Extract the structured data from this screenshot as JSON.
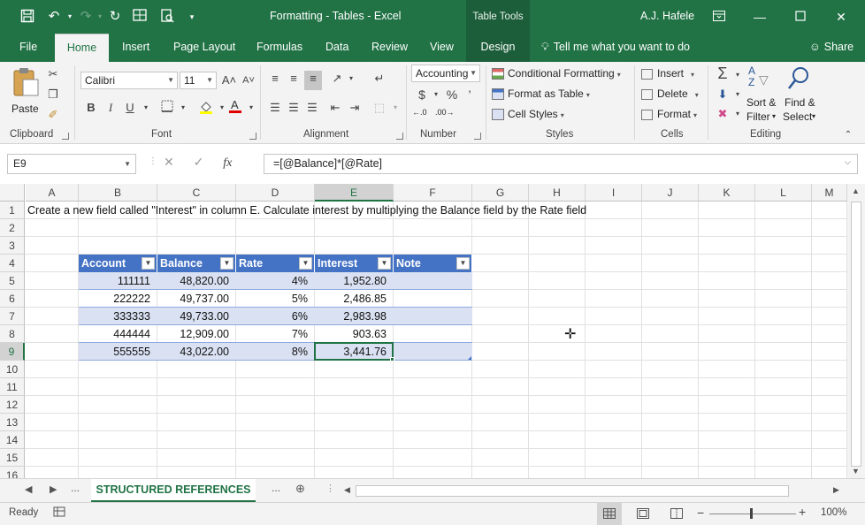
{
  "title_bar": {
    "document_title": "Formatting - Tables  -  Excel",
    "context_tools": "Table Tools",
    "user_name": "A.J. Hafele",
    "theme_color": "#217346"
  },
  "tabs": {
    "items": [
      "File",
      "Home",
      "Insert",
      "Page Layout",
      "Formulas",
      "Data",
      "Review",
      "View",
      "Design"
    ],
    "active": "Home",
    "tell_me": "Tell me what you want to do",
    "share": "Share"
  },
  "ribbon": {
    "clipboard": {
      "label": "Clipboard",
      "paste": "Paste"
    },
    "font": {
      "label": "Font",
      "font_name": "Calibri",
      "font_size": "11",
      "bold": "B",
      "italic": "I",
      "underline": "U"
    },
    "alignment": {
      "label": "Alignment"
    },
    "number": {
      "label": "Number",
      "format": "Accounting",
      "currency": "$",
      "percent": "%",
      "comma": "’",
      "increase_decimal": "←.0",
      "decrease_decimal": ".00→"
    },
    "styles": {
      "label": "Styles",
      "conditional_formatting": "Conditional Formatting",
      "format_as_table": "Format as Table",
      "cell_styles": "Cell Styles"
    },
    "cells": {
      "label": "Cells",
      "insert": "Insert",
      "delete": "Delete",
      "format": "Format"
    },
    "editing": {
      "label": "Editing",
      "sort_filter_1": "Sort &",
      "sort_filter_2": "Filter",
      "find_select_1": "Find &",
      "find_select_2": "Select"
    }
  },
  "formula_bar": {
    "name_box": "E9",
    "formula": "=[@Balance]*[@Rate]"
  },
  "grid": {
    "columns": [
      "A",
      "B",
      "C",
      "D",
      "E",
      "F",
      "G",
      "H",
      "I",
      "J",
      "K",
      "L",
      "M"
    ],
    "selected_column": "E",
    "rows": [
      "1",
      "2",
      "3",
      "4",
      "5",
      "6",
      "7",
      "8",
      "9",
      "10",
      "11",
      "12",
      "13",
      "14",
      "15",
      "16"
    ],
    "selected_row": "9",
    "a1_text": "Create a new field called \"Interest\" in column E.  Calculate interest by multiplying the Balance field by the Rate field"
  },
  "table": {
    "headers": [
      "Account",
      "Balance",
      "Rate",
      "Interest",
      "Note"
    ],
    "header_color": "#4472c4",
    "band_color": "#d9e1f2",
    "rows": [
      [
        "111111",
        "48,820.00",
        "4%",
        "1,952.80",
        ""
      ],
      [
        "222222",
        "49,737.00",
        "5%",
        "2,486.85",
        ""
      ],
      [
        "333333",
        "49,733.00",
        "6%",
        "2,983.98",
        ""
      ],
      [
        "444444",
        "12,909.00",
        "7%",
        "903.63",
        ""
      ],
      [
        "555555",
        "43,022.00",
        "8%",
        "3,441.76",
        ""
      ]
    ]
  },
  "sheet_tabs": {
    "active": "STRUCTURED REFERENCES",
    "ellipsis_left": "...",
    "ellipsis_right": "..."
  },
  "status_bar": {
    "status": "Ready",
    "zoom": "100%"
  }
}
